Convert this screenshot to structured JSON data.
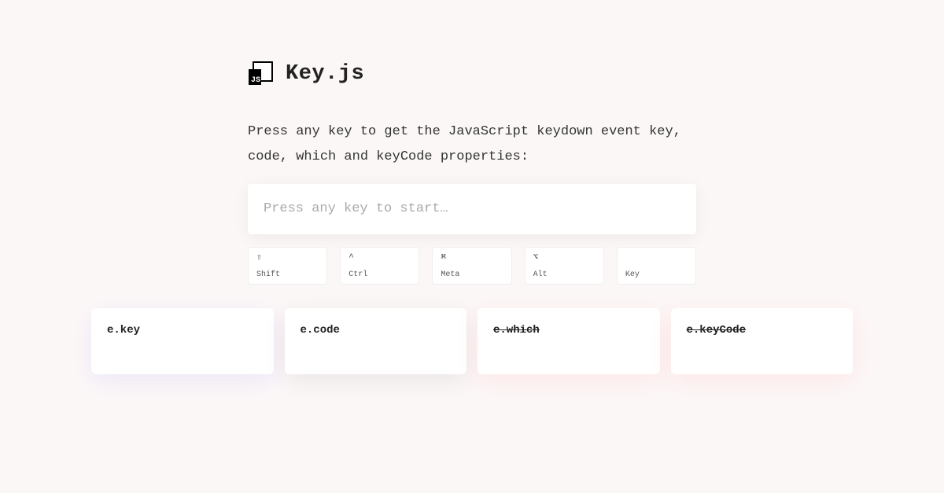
{
  "header": {
    "title": "Key.js"
  },
  "description": "Press any key to get the JavaScript keydown event key, code, which and keyCode properties:",
  "input": {
    "placeholder": "Press any key to start…"
  },
  "modifiers": [
    {
      "symbol": "⇧",
      "label": "Shift"
    },
    {
      "symbol": "^",
      "label": "Ctrl"
    },
    {
      "symbol": "⌘",
      "label": "Meta"
    },
    {
      "symbol": "⌥",
      "label": "Alt"
    },
    {
      "symbol": "",
      "label": "Key"
    }
  ],
  "results": [
    {
      "label": "e.key",
      "deprecated": false
    },
    {
      "label": "e.code",
      "deprecated": false
    },
    {
      "label": "e.which",
      "deprecated": true
    },
    {
      "label": "e.keyCode",
      "deprecated": true
    }
  ]
}
